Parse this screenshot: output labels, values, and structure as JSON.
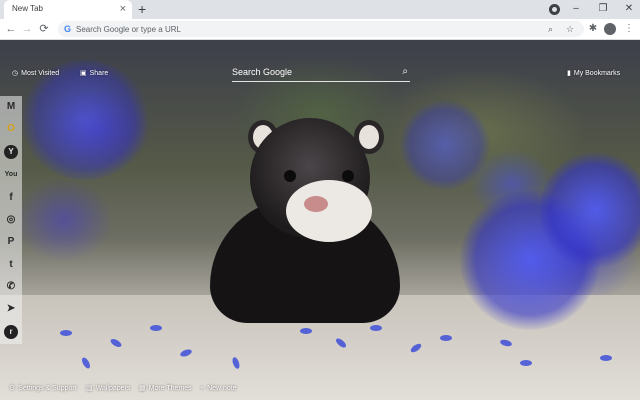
{
  "tab": {
    "title": "New Tab",
    "close_symbol": "×",
    "new_tab_symbol": "+"
  },
  "window_controls": {
    "minimize": "–",
    "restore": "❐",
    "close": "✕"
  },
  "toolbar": {
    "back_symbol": "←",
    "forward_symbol": "→",
    "reload_symbol": "⟳",
    "google_logo": "G",
    "omnibox_placeholder": "Search Google or type a URL",
    "menu_symbol": "⋮"
  },
  "top_bar": {
    "most_visited": "Most Visited",
    "share": "Share",
    "search_placeholder": "Search Google",
    "my_bookmarks": "My Bookmarks"
  },
  "sidebar": {
    "items": [
      {
        "icon": "gmail-icon",
        "glyph": "M"
      },
      {
        "icon": "outlook-icon",
        "glyph": "O"
      },
      {
        "icon": "yahoo-icon",
        "glyph": "Y"
      },
      {
        "icon": "youtube-icon",
        "glyph": "You"
      },
      {
        "icon": "facebook-icon",
        "glyph": "f"
      },
      {
        "icon": "instagram-icon",
        "glyph": "◎"
      },
      {
        "icon": "pinterest-icon",
        "glyph": "P"
      },
      {
        "icon": "twitter-icon",
        "glyph": "t"
      },
      {
        "icon": "whatsapp-icon",
        "glyph": "✆"
      },
      {
        "icon": "telegram-icon",
        "glyph": "➤"
      },
      {
        "icon": "reddit-icon",
        "glyph": "r"
      }
    ]
  },
  "bottom_bar": {
    "settings_support": "Settings & Support",
    "wallpapers": "Wallpapers",
    "more_themes": "More Themes",
    "new_note": "New note"
  },
  "colors": {
    "tabstrip": "#dee1e6",
    "accent": "#4285f4",
    "overlay_text": "#ffffff"
  }
}
